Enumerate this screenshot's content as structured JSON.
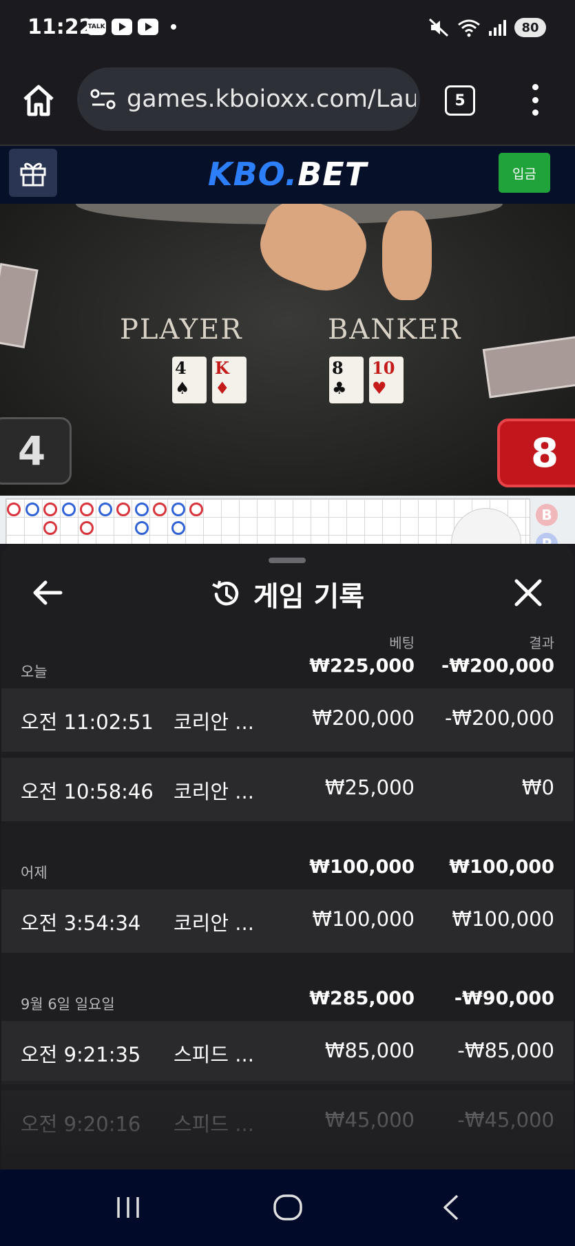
{
  "status_bar": {
    "time": "11:22",
    "talk_badge": "TALK",
    "battery": "80"
  },
  "browser": {
    "url": "games.kboioxx.com/Launch",
    "tab_count": "5"
  },
  "site": {
    "logo_part1": "KBO.",
    "logo_part2": "BET",
    "deposit_label": "입금"
  },
  "video": {
    "player_label": "PLAYER",
    "banker_label": "BANKER",
    "player_cards": [
      {
        "rank": "4",
        "suit": "♠",
        "color": "#111111"
      },
      {
        "rank": "K",
        "suit": "♦",
        "color": "#c41a1a"
      }
    ],
    "banker_cards": [
      {
        "rank": "8",
        "suit": "♣",
        "color": "#111111"
      },
      {
        "rank": "10",
        "suit": "♥",
        "color": "#c41a1a"
      }
    ],
    "player_score": "4",
    "banker_score": "8",
    "roadmap_side_labels": [
      "B",
      "P"
    ]
  },
  "history": {
    "title": "게임 기록",
    "col_bet": "베팅",
    "col_result": "결과",
    "groups": [
      {
        "label": "오늘",
        "bet_total": "₩225,000",
        "result_total": "-₩200,000",
        "rows": [
          {
            "time": "오전 11:02:51",
            "game": "코리안 ...",
            "bet": "₩200,000",
            "result": "-₩200,000"
          },
          {
            "time": "오전 10:58:46",
            "game": "코리안 ...",
            "bet": "₩25,000",
            "result": "₩0"
          }
        ]
      },
      {
        "label": "어제",
        "bet_total": "₩100,000",
        "result_total": "₩100,000",
        "rows": [
          {
            "time": "오전 3:54:34",
            "game": "코리안 ...",
            "bet": "₩100,000",
            "result": "₩100,000"
          }
        ]
      },
      {
        "label": "9월 6일 일요일",
        "bet_total": "₩285,000",
        "result_total": "-₩90,000",
        "rows": [
          {
            "time": "오전 9:21:35",
            "game": "스피드 ...",
            "bet": "₩85,000",
            "result": "-₩85,000"
          },
          {
            "time": "오전 9:20:16",
            "game": "스피드 ...",
            "bet": "₩45,000",
            "result": "-₩45,000"
          }
        ]
      }
    ]
  },
  "colors": {
    "brand_blue": "#2d7ff9",
    "deposit_green": "#1fa33a",
    "banker_red": "#c0161c",
    "sheet_bg": "#1e1e21",
    "nav_bg": "#020a2a"
  },
  "icons": [
    "home-icon",
    "site-settings-icon",
    "tabs-icon",
    "more-menu-icon",
    "gift-icon",
    "back-arrow-icon",
    "history-icon",
    "close-icon",
    "recents-icon",
    "home-nav-icon",
    "back-nav-icon"
  ]
}
